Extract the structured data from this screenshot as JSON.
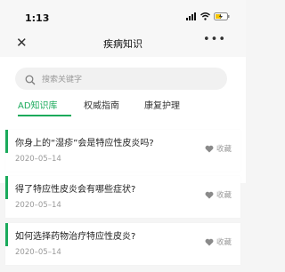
{
  "status": {
    "time": "1:13"
  },
  "nav": {
    "title": "疾病知识"
  },
  "search": {
    "placeholder": "搜索关键字"
  },
  "tabs": [
    {
      "label": "AD知识库",
      "active": true
    },
    {
      "label": "权威指南",
      "active": false
    },
    {
      "label": "康复护理",
      "active": false
    }
  ],
  "articles": [
    {
      "title": "你身上的“湿疹”会是特应性皮炎吗?",
      "date": "2020–05–14",
      "fav": "收藏"
    },
    {
      "title": "得了特应性皮炎会有哪些症状?",
      "date": "2020–05–14",
      "fav": "收藏"
    },
    {
      "title": "如何选择药物治疗特应性皮炎?",
      "date": "2020–05–14",
      "fav": "收藏"
    }
  ],
  "colors": {
    "accent": "#1aaa5b",
    "background": "#f5f5f5"
  }
}
